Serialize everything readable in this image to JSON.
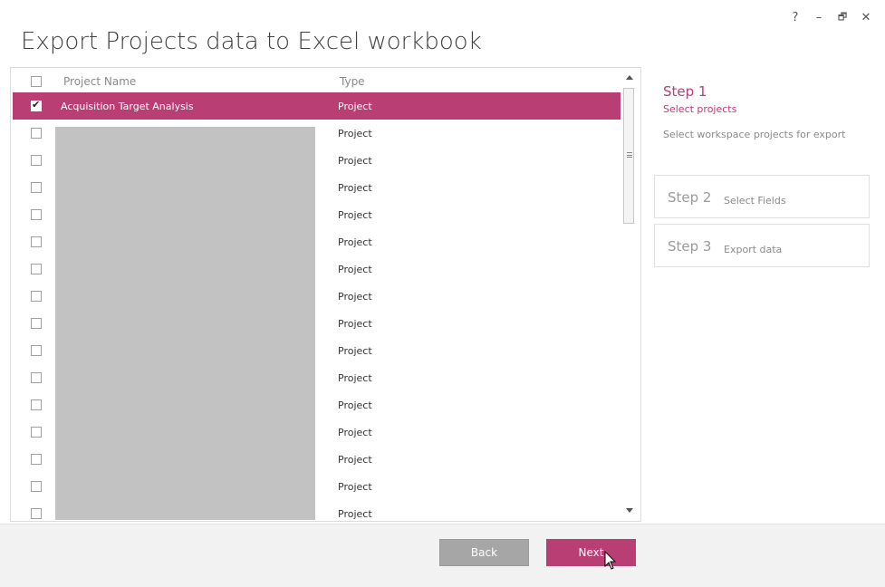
{
  "window": {
    "title": "Export Projects data to Excel workbook",
    "controls": {
      "help": "?",
      "minimize": "–",
      "restore": "🗗",
      "close": "✕"
    }
  },
  "list": {
    "columns": {
      "name": "Project Name",
      "type": "Type"
    },
    "rows": [
      {
        "name": "Acquisition Target Analysis",
        "type": "Project",
        "checked": true,
        "selected": true
      },
      {
        "name": "",
        "type": "Project",
        "checked": false
      },
      {
        "name": "",
        "type": "Project",
        "checked": false
      },
      {
        "name": "",
        "type": "Project",
        "checked": false
      },
      {
        "name": "",
        "type": "Project",
        "checked": false
      },
      {
        "name": "",
        "type": "Project",
        "checked": false
      },
      {
        "name": "",
        "type": "Project",
        "checked": false
      },
      {
        "name": "",
        "type": "Project",
        "checked": false
      },
      {
        "name": "",
        "type": "Project",
        "checked": false
      },
      {
        "name": "",
        "type": "Project",
        "checked": false
      },
      {
        "name": "",
        "type": "Project",
        "checked": false
      },
      {
        "name": "",
        "type": "Project",
        "checked": false
      },
      {
        "name": "",
        "type": "Project",
        "checked": false
      },
      {
        "name": "",
        "type": "Project",
        "checked": false
      },
      {
        "name": "",
        "type": "Project",
        "checked": false
      },
      {
        "name": "",
        "type": "Project",
        "checked": false
      }
    ]
  },
  "steps": {
    "step1": {
      "title": "Step 1",
      "subtitle": "Select projects",
      "description": "Select workspace projects for export"
    },
    "step2": {
      "number": "Step 2",
      "label": "Select Fields"
    },
    "step3": {
      "number": "Step 3",
      "label": "Export data"
    }
  },
  "footer": {
    "back_label": "Back",
    "next_label": "Next"
  },
  "colors": {
    "accent": "#b83e74",
    "back_button": "#a6a6a6",
    "redaction": "#c2c2c2"
  }
}
